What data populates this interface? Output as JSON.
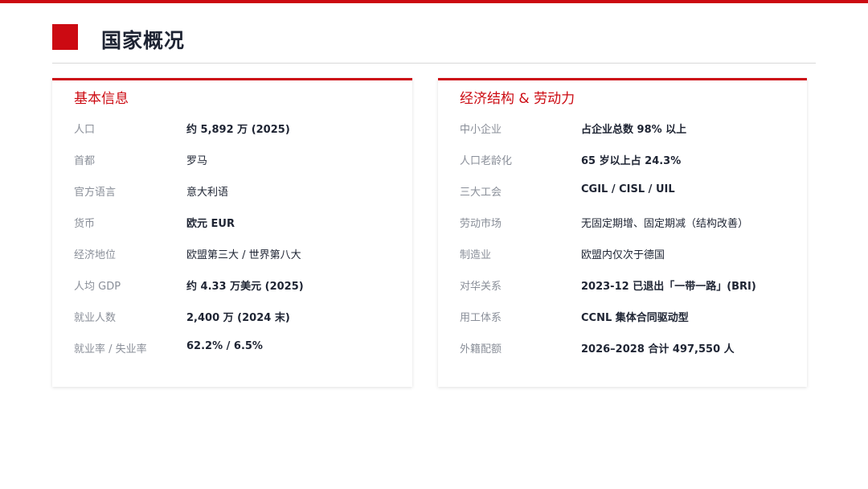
{
  "page": {
    "title": "国家概况"
  },
  "colors": {
    "accent": "#cc0a12",
    "text": "#1e2433",
    "label": "#8a8f99",
    "rule": "#d9d9d9"
  },
  "basic_info": {
    "heading": "基本信息",
    "rows": [
      {
        "label": "人口",
        "value": "约 5,892 万 (2025)"
      },
      {
        "label": "首都",
        "value": "罗马"
      },
      {
        "label": "官方语言",
        "value": "意大利语"
      },
      {
        "label": "货币",
        "value": "欧元 EUR"
      },
      {
        "label": "经济地位",
        "value": "欧盟第三大 / 世界第八大"
      },
      {
        "label": "人均 GDP",
        "value": "约 4.33 万美元 (2025)"
      },
      {
        "label": "就业人数",
        "value": "2,400 万 (2024 末)"
      },
      {
        "label": "就业率 / 失业率",
        "value": "62.2% / 6.5%"
      }
    ]
  },
  "economy_labor": {
    "heading": "经济结构 & 劳动力",
    "rows": [
      {
        "label": "中小企业",
        "value": "占企业总数 98% 以上"
      },
      {
        "label": "人口老龄化",
        "value": "65 岁以上占 24.3%"
      },
      {
        "label": "三大工会",
        "value": "CGIL / CISL / UIL"
      },
      {
        "label": "劳动市场",
        "value": "无固定期增、固定期减（结构改善）"
      },
      {
        "label": "制造业",
        "value": "欧盟内仅次于德国"
      },
      {
        "label": "对华关系",
        "value": "2023-12 已退出「一带一路」(BRI)"
      },
      {
        "label": "用工体系",
        "value": "CCNL 集体合同驱动型"
      },
      {
        "label": "外籍配额",
        "value": "2026–2028 合计 497,550 人"
      }
    ]
  }
}
